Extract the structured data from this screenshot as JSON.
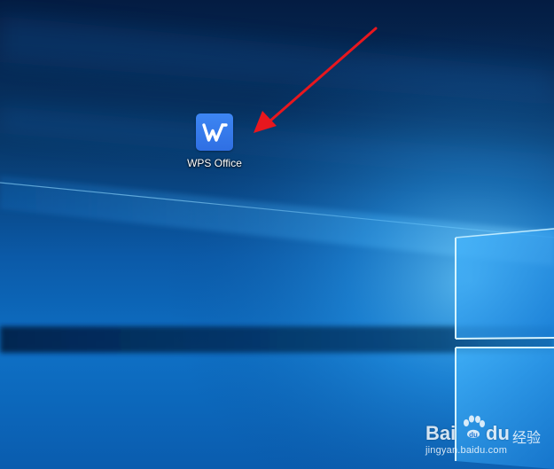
{
  "desktop": {
    "icons": [
      {
        "label": "WPS Office",
        "icon": "wps-office-icon",
        "tile_color": "#3a80ee",
        "glyph_color": "#ffffff"
      }
    ]
  },
  "annotation": {
    "arrow_color": "#e8171e"
  },
  "watermark": {
    "brand_part1": "Bai",
    "brand_part2": "du",
    "brand_cn": "经验",
    "url": "jingyan.baidu.com"
  },
  "colors": {
    "wallpaper_dark": "#041a3d",
    "wallpaper_mid": "#0a4c94",
    "wallpaper_light": "#2a9af0",
    "window_glow": "#cfefff"
  }
}
